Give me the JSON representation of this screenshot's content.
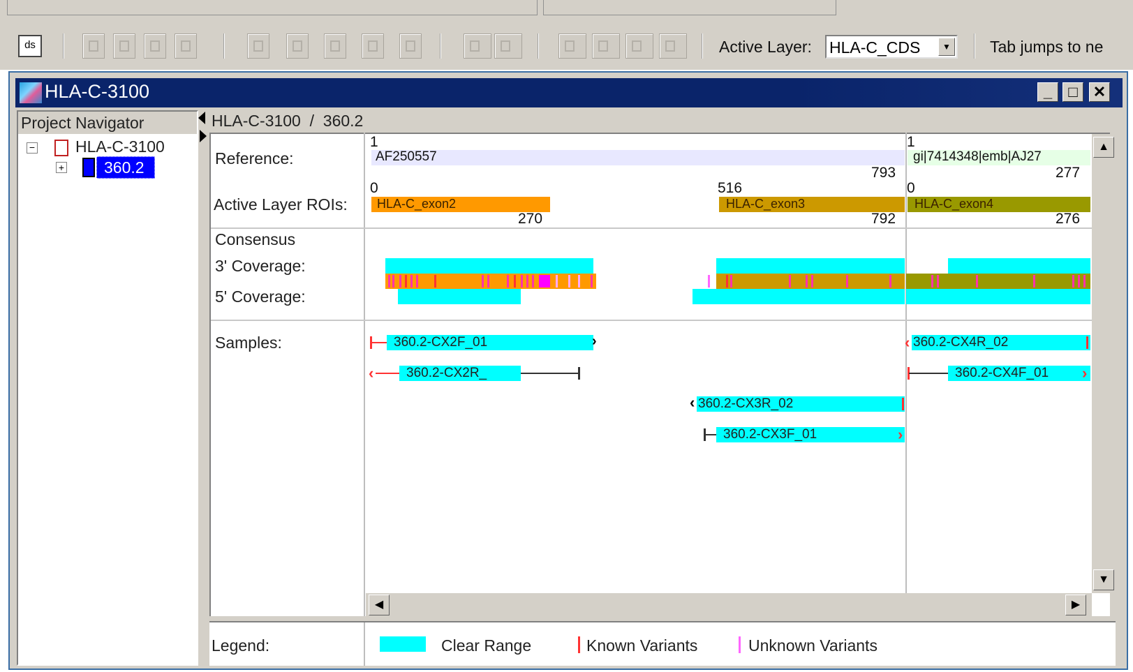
{
  "toolbar": {
    "ds_label": "ds",
    "active_layer_label": "Active Layer:",
    "active_layer_value": "HLA-C_CDS",
    "tab_hint": "Tab jumps to ne"
  },
  "window": {
    "title": "HLA-C-3100",
    "buttons": {
      "minimize": "_",
      "maximize": "□",
      "close": "✕"
    }
  },
  "navigator": {
    "header": "Project Navigator",
    "tree": [
      {
        "label": "HLA-C-3100",
        "expander": "⊟"
      },
      {
        "label": "360.2",
        "expander": "⊞",
        "selected": true
      }
    ]
  },
  "breadcrumb": "HLA-C-3100  /  360.2",
  "row_labels": {
    "reference": "Reference:",
    "active_rois": "Active Layer ROIs:",
    "consensus": "Consensus",
    "cov3": "3' Coverage:",
    "cov5": "5' Coverage:",
    "samples": "Samples:",
    "legend": "Legend:"
  },
  "reference": [
    {
      "name": "AF250557",
      "start": "1",
      "end": "793"
    },
    {
      "name": "gi|7414348|emb|AJ27",
      "start": "1",
      "end": "277"
    }
  ],
  "rois": [
    {
      "name": "HLA-C_exon2",
      "start": "0",
      "end": "270",
      "color": "#ff9900"
    },
    {
      "name": "HLA-C_exon3",
      "start": "516",
      "end": "792",
      "color": "#cc9900"
    },
    {
      "name": "HLA-C_exon4",
      "start": "0",
      "end": "276",
      "color": "#999900"
    }
  ],
  "samples": [
    "360.2-CX2F_01",
    "360.2-CX2R_",
    "360.2-CX4R_02",
    "360.2-CX4F_01",
    "360.2-CX3R_02",
    "360.2-CX3F_01"
  ],
  "legend": {
    "clear_range": "Clear Range",
    "known_variants": "Known Variants",
    "unknown_variants": "Unknown Variants",
    "colors": {
      "clear_range": "#00ffff",
      "known": "#ff3333",
      "unknown": "#ff66ff"
    }
  },
  "scroll_icons": {
    "up": "▲",
    "down": "▼",
    "left": "◀",
    "right": "▶"
  }
}
